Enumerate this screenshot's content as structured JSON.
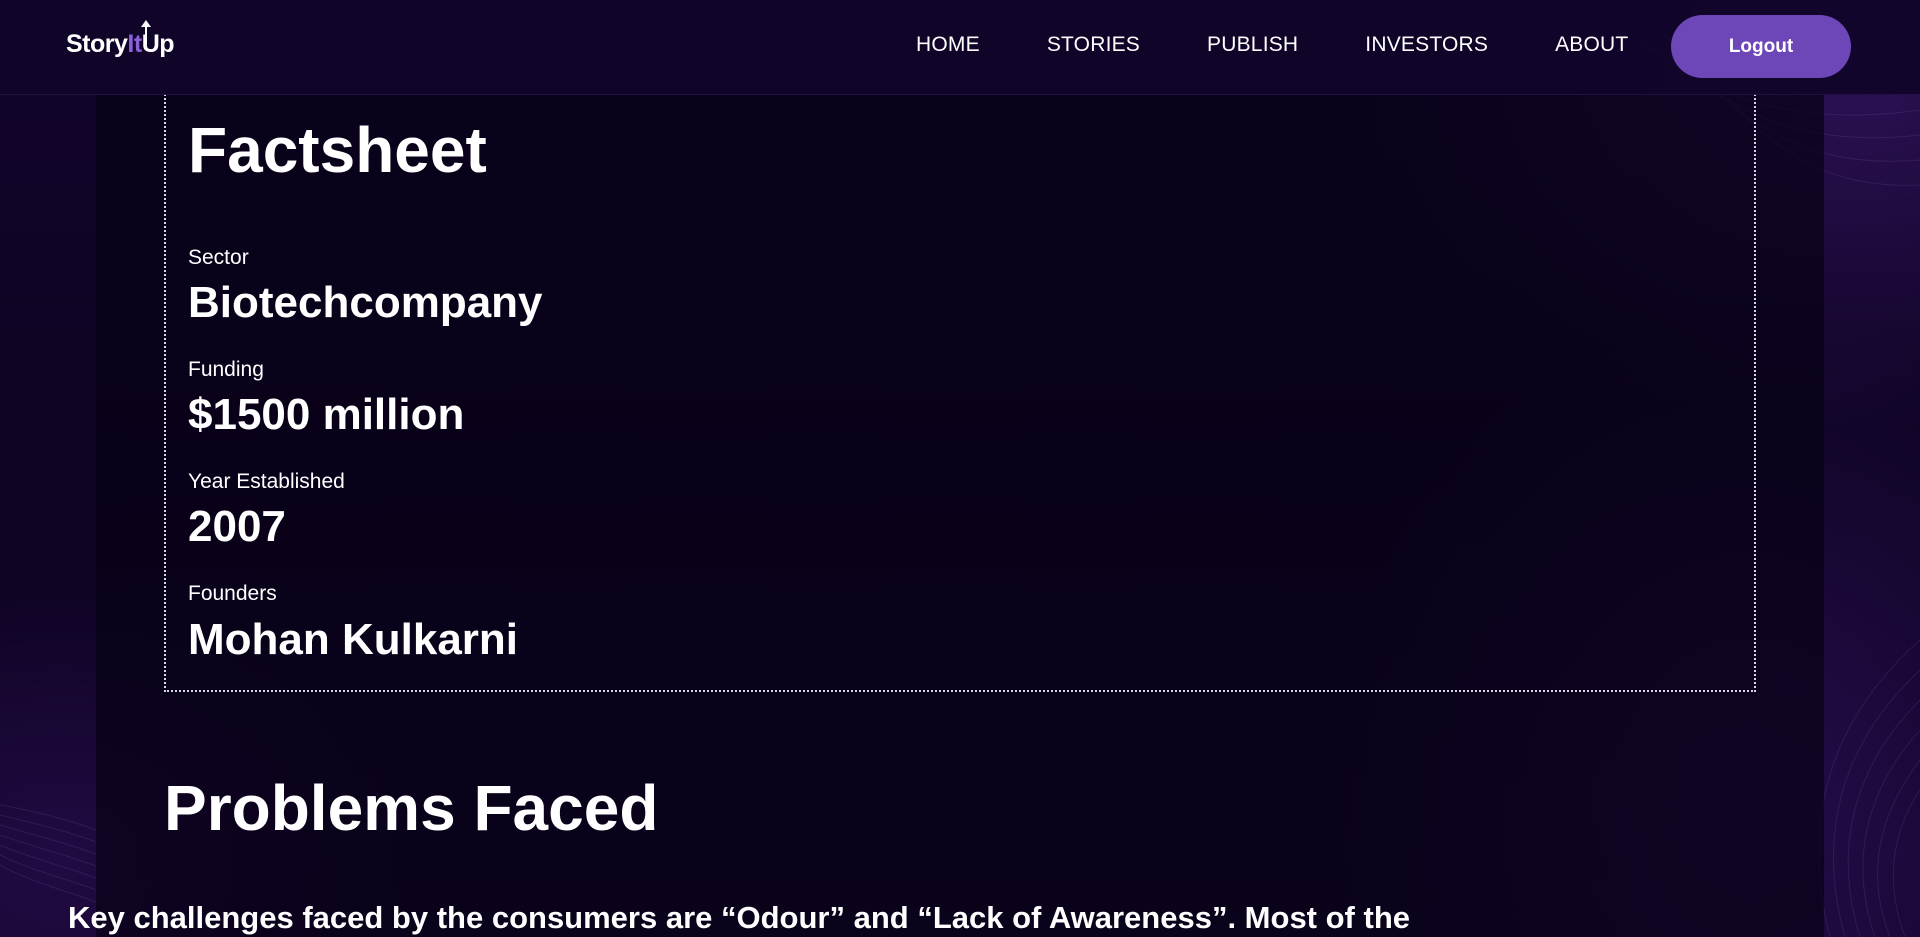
{
  "header": {
    "logo": {
      "prefix": "Story",
      "accent": "It",
      "suffix": "Up"
    },
    "nav": [
      {
        "label": "HOME"
      },
      {
        "label": "STORIES"
      },
      {
        "label": "PUBLISH"
      },
      {
        "label": "INVESTORS"
      },
      {
        "label": "ABOUT"
      }
    ],
    "logout_label": "Logout"
  },
  "factsheet": {
    "title": "Factsheet",
    "facts": [
      {
        "label": "Sector",
        "value": "Biotechcompany"
      },
      {
        "label": "Funding",
        "value": "$1500 million"
      },
      {
        "label": "Year Established",
        "value": "2007"
      },
      {
        "label": "Founders",
        "value": "Mohan Kulkarni"
      }
    ]
  },
  "problems": {
    "title": "Problems Faced",
    "text": "Key challenges faced by the consumers are “Odour” and “Lack of Awareness”. Most of the"
  },
  "colors": {
    "accent": "#6d46b8",
    "logo_accent": "#8a5fd9",
    "background": "#0f0424"
  }
}
